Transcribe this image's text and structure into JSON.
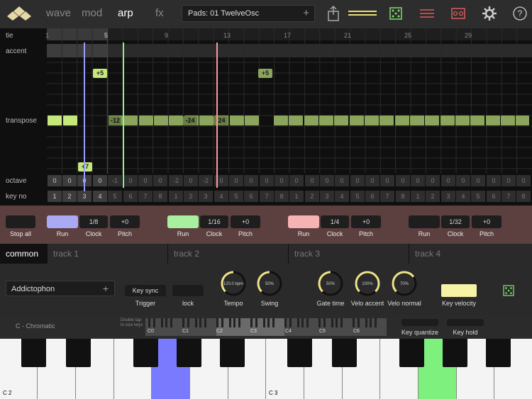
{
  "topbar": {
    "tabs": [
      "wave",
      "mod",
      "arp",
      "fx"
    ],
    "active_tab": "arp",
    "preset_label": "Pads: 01 TwelveOsc",
    "preset_add": "+"
  },
  "grid": {
    "row_labels": {
      "tie": "tie",
      "accent": "accent",
      "transpose": "transpose",
      "octave": "octave",
      "key_no": "key no"
    },
    "step_numbers": [
      "1",
      "5",
      "9",
      "13",
      "17",
      "21",
      "25",
      "29"
    ],
    "transpose_tags": [
      "+5",
      "+5",
      "-12",
      "-24",
      "-24",
      "+7"
    ],
    "octave_values": [
      "0",
      "0",
      "0",
      "0",
      "-1",
      "0",
      "0",
      "0",
      "-2",
      "0",
      "-2",
      "0",
      "0",
      "0",
      "0",
      "0",
      "0",
      "0",
      "0",
      "0",
      "0",
      "0",
      "0",
      "0",
      "0",
      "0",
      "0",
      "0",
      "0",
      "0",
      "0",
      "0"
    ],
    "key_values": [
      "1",
      "2",
      "3",
      "4",
      "5",
      "6",
      "7",
      "8",
      "1",
      "2",
      "3",
      "4",
      "5",
      "6",
      "7",
      "8",
      "1",
      "2",
      "3",
      "4",
      "5",
      "6",
      "7",
      "8",
      "1",
      "2",
      "3",
      "4",
      "5",
      "6",
      "7",
      "8"
    ]
  },
  "transport": {
    "stop_all": "Stop all",
    "tracks": [
      {
        "run": "Run",
        "clock_value": "1/8",
        "clock": "Clock",
        "pitch_value": "+0",
        "pitch": "Pitch",
        "color": "#a9a9f5"
      },
      {
        "run": "Run",
        "clock_value": "1/16",
        "clock": "Clock",
        "pitch_value": "+0",
        "pitch": "Pitch",
        "color": "#a9efa0"
      },
      {
        "run": "Run",
        "clock_value": "1/4",
        "clock": "Clock",
        "pitch_value": "+0",
        "pitch": "Pitch",
        "color": "#f7b3b3"
      },
      {
        "run": "Run",
        "clock_value": "1/32",
        "clock": "Clock",
        "pitch_value": "+0",
        "pitch": "Pitch",
        "color": "#1e1e1e"
      }
    ]
  },
  "tabs": [
    "common",
    "track 1",
    "track 2",
    "track 3",
    "track 4"
  ],
  "common": {
    "pattern_name": "Addictophon",
    "pattern_add": "+",
    "key_sync": "Key sync",
    "trigger": "Trigger",
    "lock": "lock",
    "tempo_value": "120.0 bpm",
    "tempo": "Tempo",
    "tempo_level": 0.5,
    "swing_value": "50%",
    "swing": "Swing",
    "swing_level": 0.5,
    "gate_value": "50%",
    "gate": "Gate time",
    "gate_level": 0.5,
    "velo_accent_value": "100%",
    "velo_accent": "Velo accent",
    "velo_accent_level": 1.0,
    "velo_normal_value": "70%",
    "velo_normal": "Velo normal",
    "velo_normal_level": 0.7,
    "key_velocity": "Key velocity"
  },
  "kbstrip": {
    "scale": "C - Chromatic",
    "hint_line1": "Double tap",
    "hint_line2": "to size keys",
    "octave_labels": [
      "C0",
      "C1",
      "C2",
      "C3",
      "C4",
      "C5",
      "C6"
    ],
    "key_quantize": "Key quantize",
    "key_hold": "Key hold"
  },
  "keyboard": {
    "labels": [
      "C 2",
      "C 3"
    ],
    "highlight_blue": "#7a7aff",
    "highlight_green": "#7ef07e"
  }
}
